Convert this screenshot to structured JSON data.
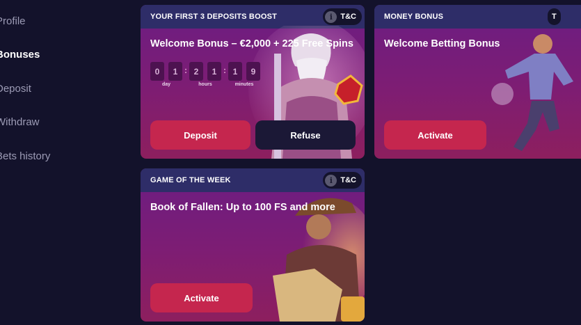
{
  "sidebar": {
    "items": [
      {
        "label": "Profile"
      },
      {
        "label": "Bonuses",
        "active": true
      },
      {
        "label": "Deposit"
      },
      {
        "label": "Withdraw"
      },
      {
        "label": "Bets history"
      }
    ]
  },
  "cards": {
    "deposit_boost": {
      "header": "YOUR FIRST 3 DEPOSITS BOOST",
      "tc": "T&C",
      "info_icon_glyph": "i",
      "title": "Welcome Bonus – €2,000 + 225 Free Spins",
      "timer": {
        "digits": [
          "0",
          "1",
          "2",
          "1",
          "1",
          "9"
        ],
        "separator": ":",
        "labels": {
          "day": "day",
          "hours": "hours",
          "minutes": "minutes"
        }
      },
      "deposit_label": "Deposit",
      "refuse_label": "Refuse",
      "art": "zeus-character-with-red-gem"
    },
    "money_bonus": {
      "header": "MONEY BONUS",
      "tc": "T",
      "title": "Welcome Betting Bonus",
      "activate_label": "Activate",
      "art": "football-player-kicking-ball"
    },
    "game_of_week": {
      "header": "GAME OF THE WEEK",
      "tc": "T&C",
      "info_icon_glyph": "i",
      "title": "Book of Fallen: Up to 100 FS and more",
      "activate_label": "Activate",
      "art": "explorer-with-hat-and-map"
    }
  },
  "colors": {
    "background": "#13122b",
    "card_header": "#2e2d68",
    "button_primary": "#c5264e",
    "button_dark": "#1b1836"
  }
}
